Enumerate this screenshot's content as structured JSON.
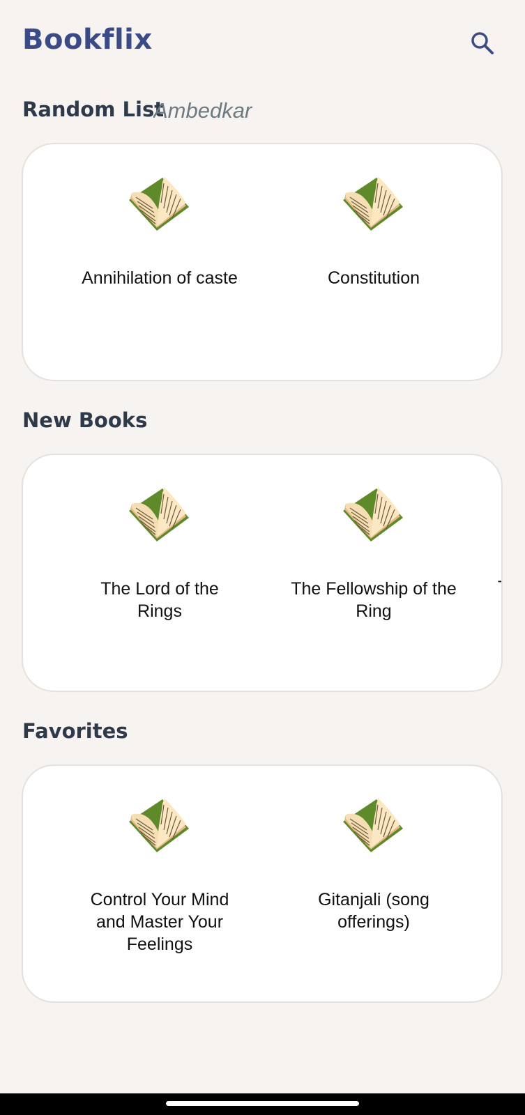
{
  "app": {
    "title": "Bookflix"
  },
  "sections": {
    "random": {
      "title": "Random List",
      "subtitle": "Ambedkar",
      "books": [
        {
          "title": "Annihilation of caste"
        },
        {
          "title": "Constitution"
        }
      ]
    },
    "new_books": {
      "title": "New Books",
      "books": [
        {
          "title": "The Lord of the Rings"
        },
        {
          "title": "The Fellowship of the Ring"
        }
      ],
      "peek_text": "T"
    },
    "favorites": {
      "title": "Favorites",
      "books": [
        {
          "title": "Control Your Mind and Master Your Feelings"
        },
        {
          "title": "Gitanjali (song offerings)"
        }
      ]
    }
  },
  "icons": {
    "search": "search-icon",
    "book": "open-book-icon"
  },
  "colors": {
    "brand": "#3a4b86",
    "background": "#f7f3f1",
    "card": "#ffffff",
    "section_text": "#2e3a4a"
  }
}
